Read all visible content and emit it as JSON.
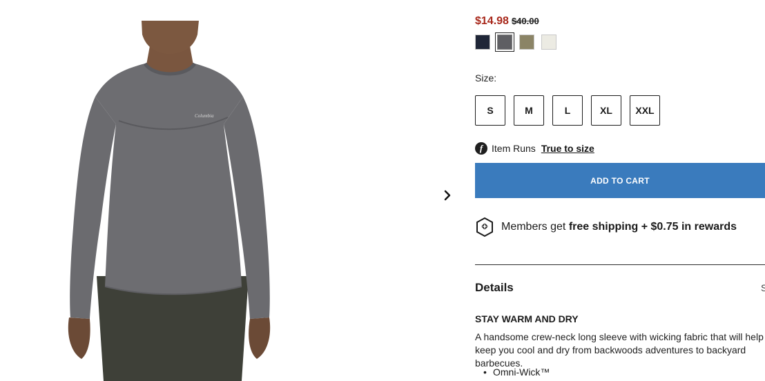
{
  "gallery": {
    "next_icon": "chevron-right-icon",
    "image_alt": "Model wearing grey crew-neck long sleeve shirt with khaki pants"
  },
  "product": {
    "sale_price": "$14.98",
    "original_price": "$40.00",
    "brand_logo_text": "Columbia"
  },
  "swatches": [
    {
      "color": "#1f2637"
    },
    {
      "color": "#5f5f63",
      "selected": true
    },
    {
      "color": "#8b8466"
    },
    {
      "color": "#ecebe3"
    }
  ],
  "size": {
    "label": "Size:",
    "options": [
      "S",
      "M",
      "L",
      "XL",
      "XXL"
    ]
  },
  "fit": {
    "icon_letter": "f",
    "prefix": "Item Runs",
    "link": "True to size"
  },
  "cart": {
    "button_label": "ADD TO CART",
    "color": "#3a7bbd"
  },
  "members": {
    "prefix": "Members get ",
    "bold": "free shipping + $0.75 in rewards"
  },
  "details": {
    "heading": "Details",
    "right_fragment": "S",
    "subheading": "STAY WARM AND DRY",
    "description": "A handsome crew-neck long sleeve with wicking fabric that will help keep you cool and dry from backwoods adventures to backyard barbecues.",
    "features": [
      "Omni-Wick™"
    ]
  },
  "colors": {
    "sale_price": "#a8281b",
    "accent": "#3a7bbd"
  }
}
